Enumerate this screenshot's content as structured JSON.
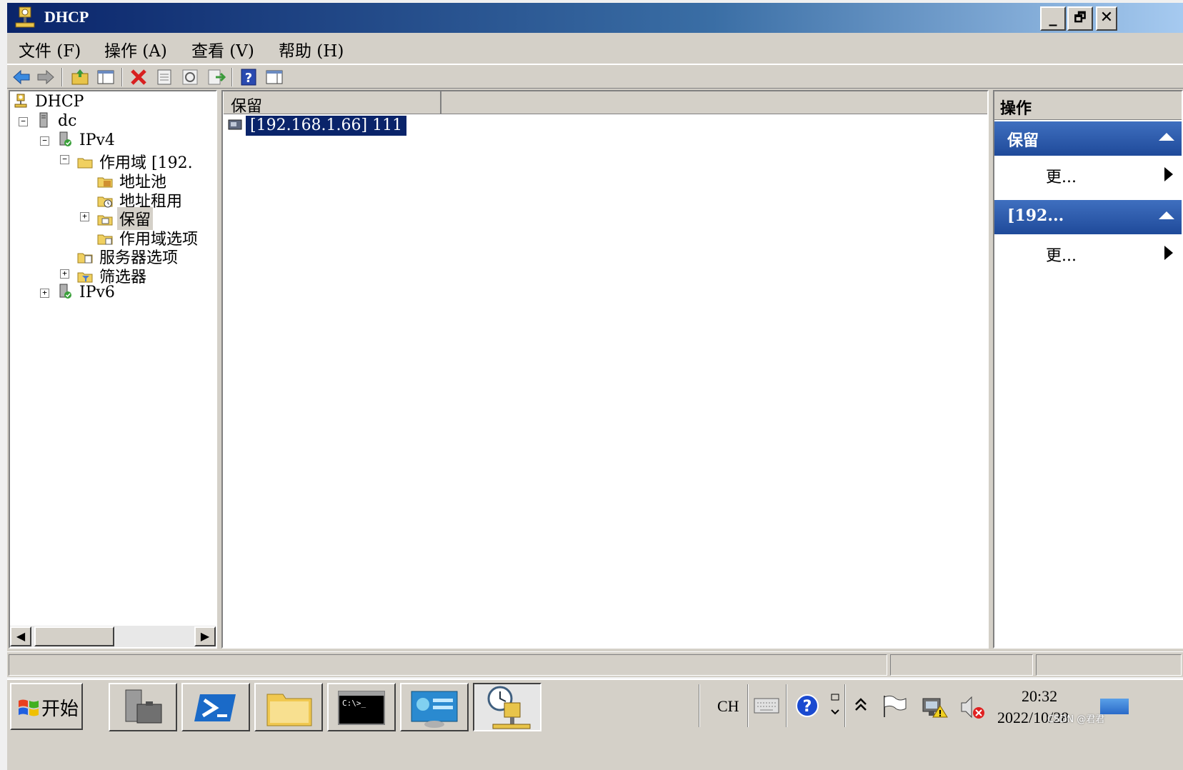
{
  "window": {
    "title": "DHCP"
  },
  "titlebar_buttons": {
    "minimize": "_",
    "restore": "🗗",
    "close": "✕"
  },
  "menu": [
    "文件 (F)",
    "操作 (A)",
    "查看 (V)",
    "帮助 (H)"
  ],
  "tree": {
    "root": "DHCP",
    "server": "dc",
    "ipv4": "IPv4",
    "scope": "作用域 [192.",
    "address_pool": "地址池",
    "address_leases": "地址租用",
    "reservations": "保留",
    "scope_options": "作用域选项",
    "server_options": "服务器选项",
    "filters": "筛选器",
    "ipv6": "IPv6"
  },
  "list": {
    "column_header": "保留",
    "rows": [
      {
        "label": "[192.168.1.66] 111"
      }
    ]
  },
  "actions": {
    "header": "操作",
    "section1_title": "保留",
    "section1_more": "更...",
    "section2_title": "[192...",
    "section2_more": "更..."
  },
  "scrollbar": {
    "left_arrow": "◀",
    "right_arrow": "▶"
  },
  "taskbar": {
    "start_label": "开始",
    "language": "CH",
    "time": "20:32",
    "date": "2022/10/28",
    "watermark": "CSDN @君君"
  },
  "colors": {
    "selection": "#0a246a",
    "action_section": "#2a5aa8",
    "chrome": "#d4d0c8"
  }
}
